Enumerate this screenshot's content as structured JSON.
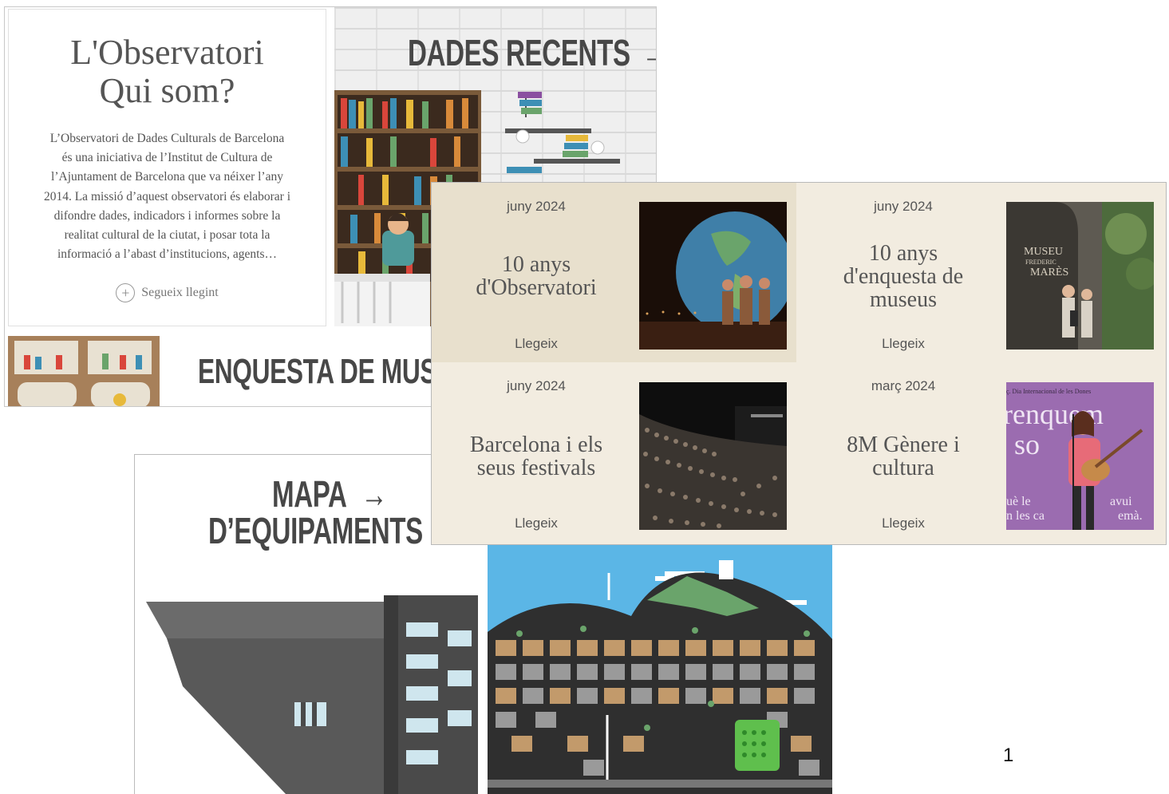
{
  "about": {
    "title_line1": "L'Observatori",
    "title_line2": "Qui som?",
    "body_line1": "L’Observatori de Dades Culturals de Barcelona",
    "body_line2": "és una iniciativa de l’Institut de Cultura de",
    "body_line3": "l’Ajuntament de Barcelona que va néixer l’any",
    "body_line4": "2014. La missió d’aquest observatori és elaborar i",
    "body_line5": "difondre dades, indicadors i informes sobre la",
    "body_line6": "realitat cultural de la ciutat, i posar tota la",
    "body_line7": "informació a l’abast d’institucions, agents…",
    "read_more": "Segueix llegint"
  },
  "tiles": {
    "dades_title": "DADES RECENTS",
    "dades_arrow": "→",
    "enquesta_title": "ENQUESTA DE MUSEUS",
    "mapa_line1": "MAPA",
    "mapa_arrow": "→",
    "mapa_line2": "D’EQUIPAMENTS"
  },
  "news": [
    {
      "date": "juny 2024",
      "title_line1": "10 anys",
      "title_line2": "d'Observatori",
      "title_line3": "",
      "read": "Llegeix"
    },
    {
      "date": "juny 2024",
      "title_line1": "10 anys",
      "title_line2": "d'enquesta de",
      "title_line3": "museus",
      "read": "Llegeix",
      "photo_text_1": "MUSEU",
      "photo_text_2": "FREDERIC",
      "photo_text_3": "MARÈS"
    },
    {
      "date": "juny 2024",
      "title_line1": "Barcelona i els",
      "title_line2": "seus festivals",
      "title_line3": "",
      "read": "Llegeix"
    },
    {
      "date": "març 2024",
      "title_line1": "8M Gènere i",
      "title_line2": "cultura",
      "title_line3": "",
      "read": "Llegeix",
      "photo_text_1": "ç. Dia Internacional de les Dones",
      "photo_text_2": "renquem",
      "photo_text_3": "so",
      "photo_text_4": "uè le",
      "photo_text_5": "avui",
      "photo_text_6": "n les ca",
      "photo_text_7": "emà."
    }
  ],
  "page_number": "1",
  "colors": {
    "news_bg_light": "#f2ece0",
    "news_bg_dark": "#e8e0cd",
    "heading": "#474747",
    "serif_text": "#555555"
  }
}
